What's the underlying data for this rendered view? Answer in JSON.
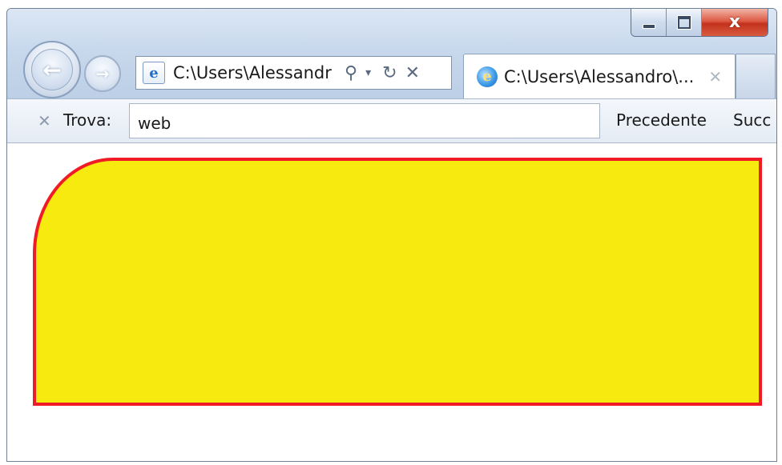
{
  "window": {
    "caption_buttons": {
      "close_label": "x"
    }
  },
  "navigation": {
    "back_icon": "back-arrow-icon",
    "forward_icon": "forward-arrow-icon"
  },
  "address_bar": {
    "url": "C:\\Users\\Alessandr",
    "page_icon": "ie-page-icon",
    "tools": {
      "search": "⚲",
      "dropdown": "▾",
      "refresh": "↻",
      "stop": "✕"
    }
  },
  "tabs": [
    {
      "title": "C:\\Users\\Alessandro\\...",
      "close": "✕",
      "icon": "ie-logo-icon"
    }
  ],
  "find_bar": {
    "close": "✕",
    "label": "Trova:",
    "value": "web",
    "previous_label": "Precedente",
    "next_label": "Succ"
  },
  "content": {
    "box_fill": "#f6ea0e",
    "box_border": "#ef1b26"
  }
}
